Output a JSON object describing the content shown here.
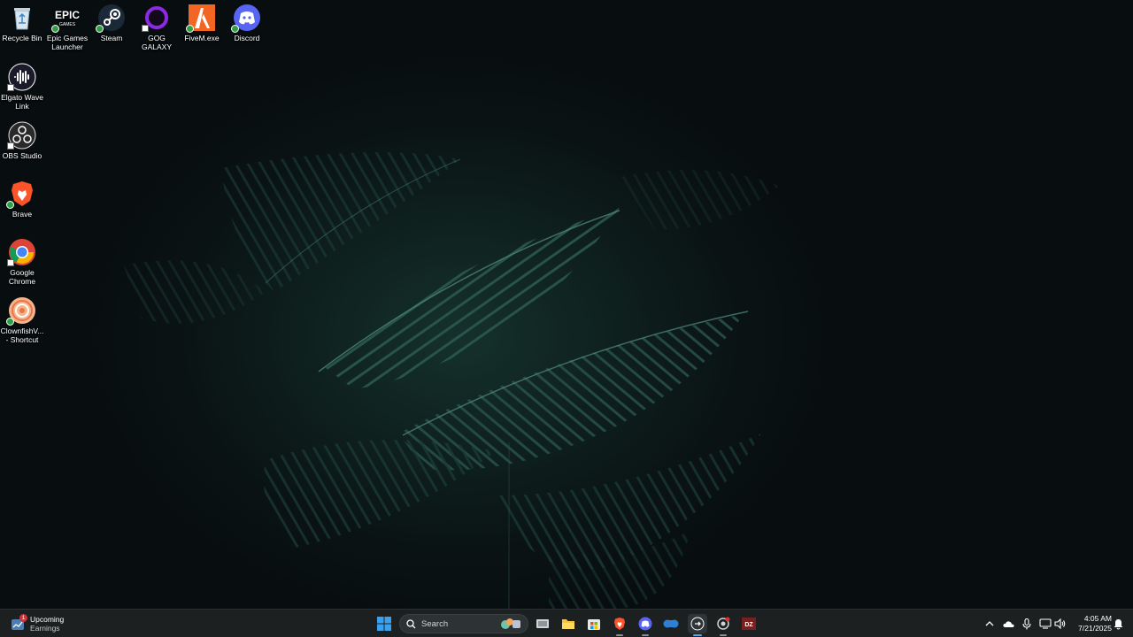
{
  "desktop": {
    "icons": [
      {
        "label": "Recycle Bin",
        "icon": "recycle-bin-icon"
      },
      {
        "label": "Epic Games Launcher",
        "icon": "epic-games-icon",
        "logo_text": "EPIC"
      },
      {
        "label": "Steam",
        "icon": "steam-icon"
      },
      {
        "label": "GOG GALAXY",
        "icon": "gog-galaxy-icon"
      },
      {
        "label": "FiveM.exe",
        "icon": "fivem-icon"
      },
      {
        "label": "Discord",
        "icon": "discord-icon"
      },
      {
        "label": "Elgato Wave Link",
        "icon": "elgato-wave-link-icon"
      },
      {
        "label": "OBS Studio",
        "icon": "obs-studio-icon"
      },
      {
        "label": "Brave",
        "icon": "brave-icon"
      },
      {
        "label": "Google Chrome",
        "icon": "google-chrome-icon"
      },
      {
        "label": "ClownfishV... - Shortcut",
        "icon": "clownfish-icon"
      }
    ]
  },
  "taskbar": {
    "widget": {
      "title": "Upcoming",
      "subtitle": "Earnings",
      "badge": "1"
    },
    "search": {
      "placeholder": "Search"
    },
    "apps": [
      {
        "name": "start-icon"
      },
      {
        "name": "search-icon"
      },
      {
        "name": "task-view-icon"
      },
      {
        "name": "file-explorer-icon"
      },
      {
        "name": "microsoft-store-icon"
      },
      {
        "name": "brave-icon"
      },
      {
        "name": "discord-icon"
      },
      {
        "name": "elgato-stream-deck-icon"
      },
      {
        "name": "wave-link-icon"
      },
      {
        "name": "steelseries-icon"
      },
      {
        "name": "dayz-icon"
      }
    ],
    "tray": {
      "icons": [
        "chevron-up-icon",
        "onedrive-icon",
        "microphone-icon",
        "network-icon",
        "volume-icon",
        "notification-icon"
      ]
    },
    "clock": {
      "time": "4:05 AM",
      "date": "7/21/2025"
    }
  },
  "colors": {
    "taskbar_bg": "#1c2021",
    "accent": "#5aa7e6",
    "discord": "#5865f2",
    "brave": "#fb542b",
    "steam": "#1b2838",
    "gog": "#8a2be2",
    "fivem": "#f26522"
  }
}
